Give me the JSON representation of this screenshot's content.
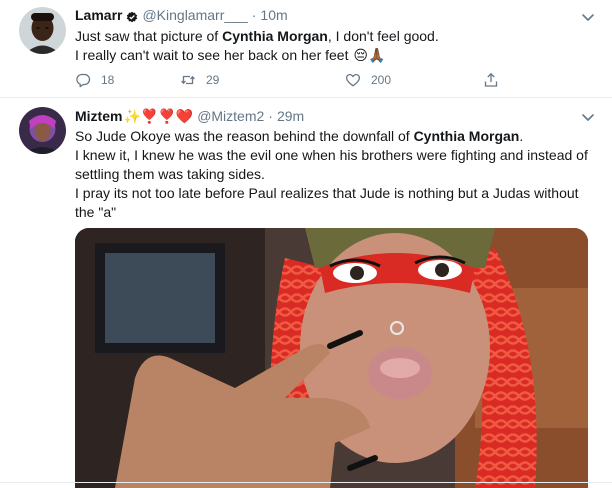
{
  "tweets": [
    {
      "name": "Lamarr",
      "handle": "@Kinglamarr___",
      "separator": "·",
      "time": "10m",
      "verified": true,
      "lines": [
        {
          "pre": "Just saw that picture of ",
          "hl": "Cynthia Morgan",
          "post": ", I don't feel good."
        },
        {
          "pre": "I really can't wait to see her back on her feet ",
          "hl": "",
          "post": ""
        }
      ],
      "line2_emoji": "😔🙏🏾",
      "stats": {
        "replies": "18",
        "retweets": "29",
        "likes": "200"
      }
    },
    {
      "name": "Miztem",
      "name_emoji": "✨❣️❣️❤️",
      "handle": "@Miztem2",
      "separator": "·",
      "time": "29m",
      "lines": [
        {
          "pre": "So Jude Okoye was the reason behind the downfall of ",
          "hl": "Cynthia Morgan",
          "post": "."
        },
        {
          "pre": "I knew it, I knew he was the evil one when his brothers were fighting and instead of",
          "hl": "",
          "post": ""
        },
        {
          "pre": "settling them was taking sides.",
          "hl": "",
          "post": ""
        },
        {
          "pre": "I pray its not too late before Paul realizes that Jude is nothing but a Judas without",
          "hl": "",
          "post": ""
        },
        {
          "pre": "the \"a\"",
          "hl": "",
          "post": ""
        }
      ]
    }
  ],
  "colors": {
    "text": "#14171a",
    "muted": "#657786",
    "border": "#e6ecf0",
    "hair_red": "#e0332b"
  },
  "icons": [
    "verified-badge-icon",
    "chevron-down-icon",
    "reply-icon",
    "retweet-icon",
    "like-icon",
    "share-icon"
  ]
}
